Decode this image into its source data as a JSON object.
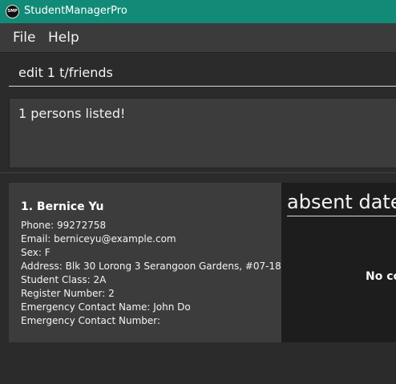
{
  "window": {
    "title": "StudentManagerPro",
    "icon_text": "SMP"
  },
  "menu": {
    "items": [
      "File",
      "Help"
    ]
  },
  "command": {
    "value": "edit 1 t/friends"
  },
  "result": {
    "text": "1 persons listed!"
  },
  "person": {
    "name": "1. Bernice Yu",
    "phone": "Phone: 99272758",
    "email": "Email: berniceyu@example.com",
    "sex": "Sex: F",
    "address": "Address: Blk 30 Lorong 3 Serangoon Gardens, #07-18",
    "student_class": "Student Class: 2A",
    "register_number": "Register Number: 2",
    "emergency_contact_name": "Emergency Contact Name: John Do",
    "emergency_contact_number": "Emergency Contact Number:"
  },
  "absent_panel": {
    "title": "absent date",
    "placeholder": "No co"
  }
}
